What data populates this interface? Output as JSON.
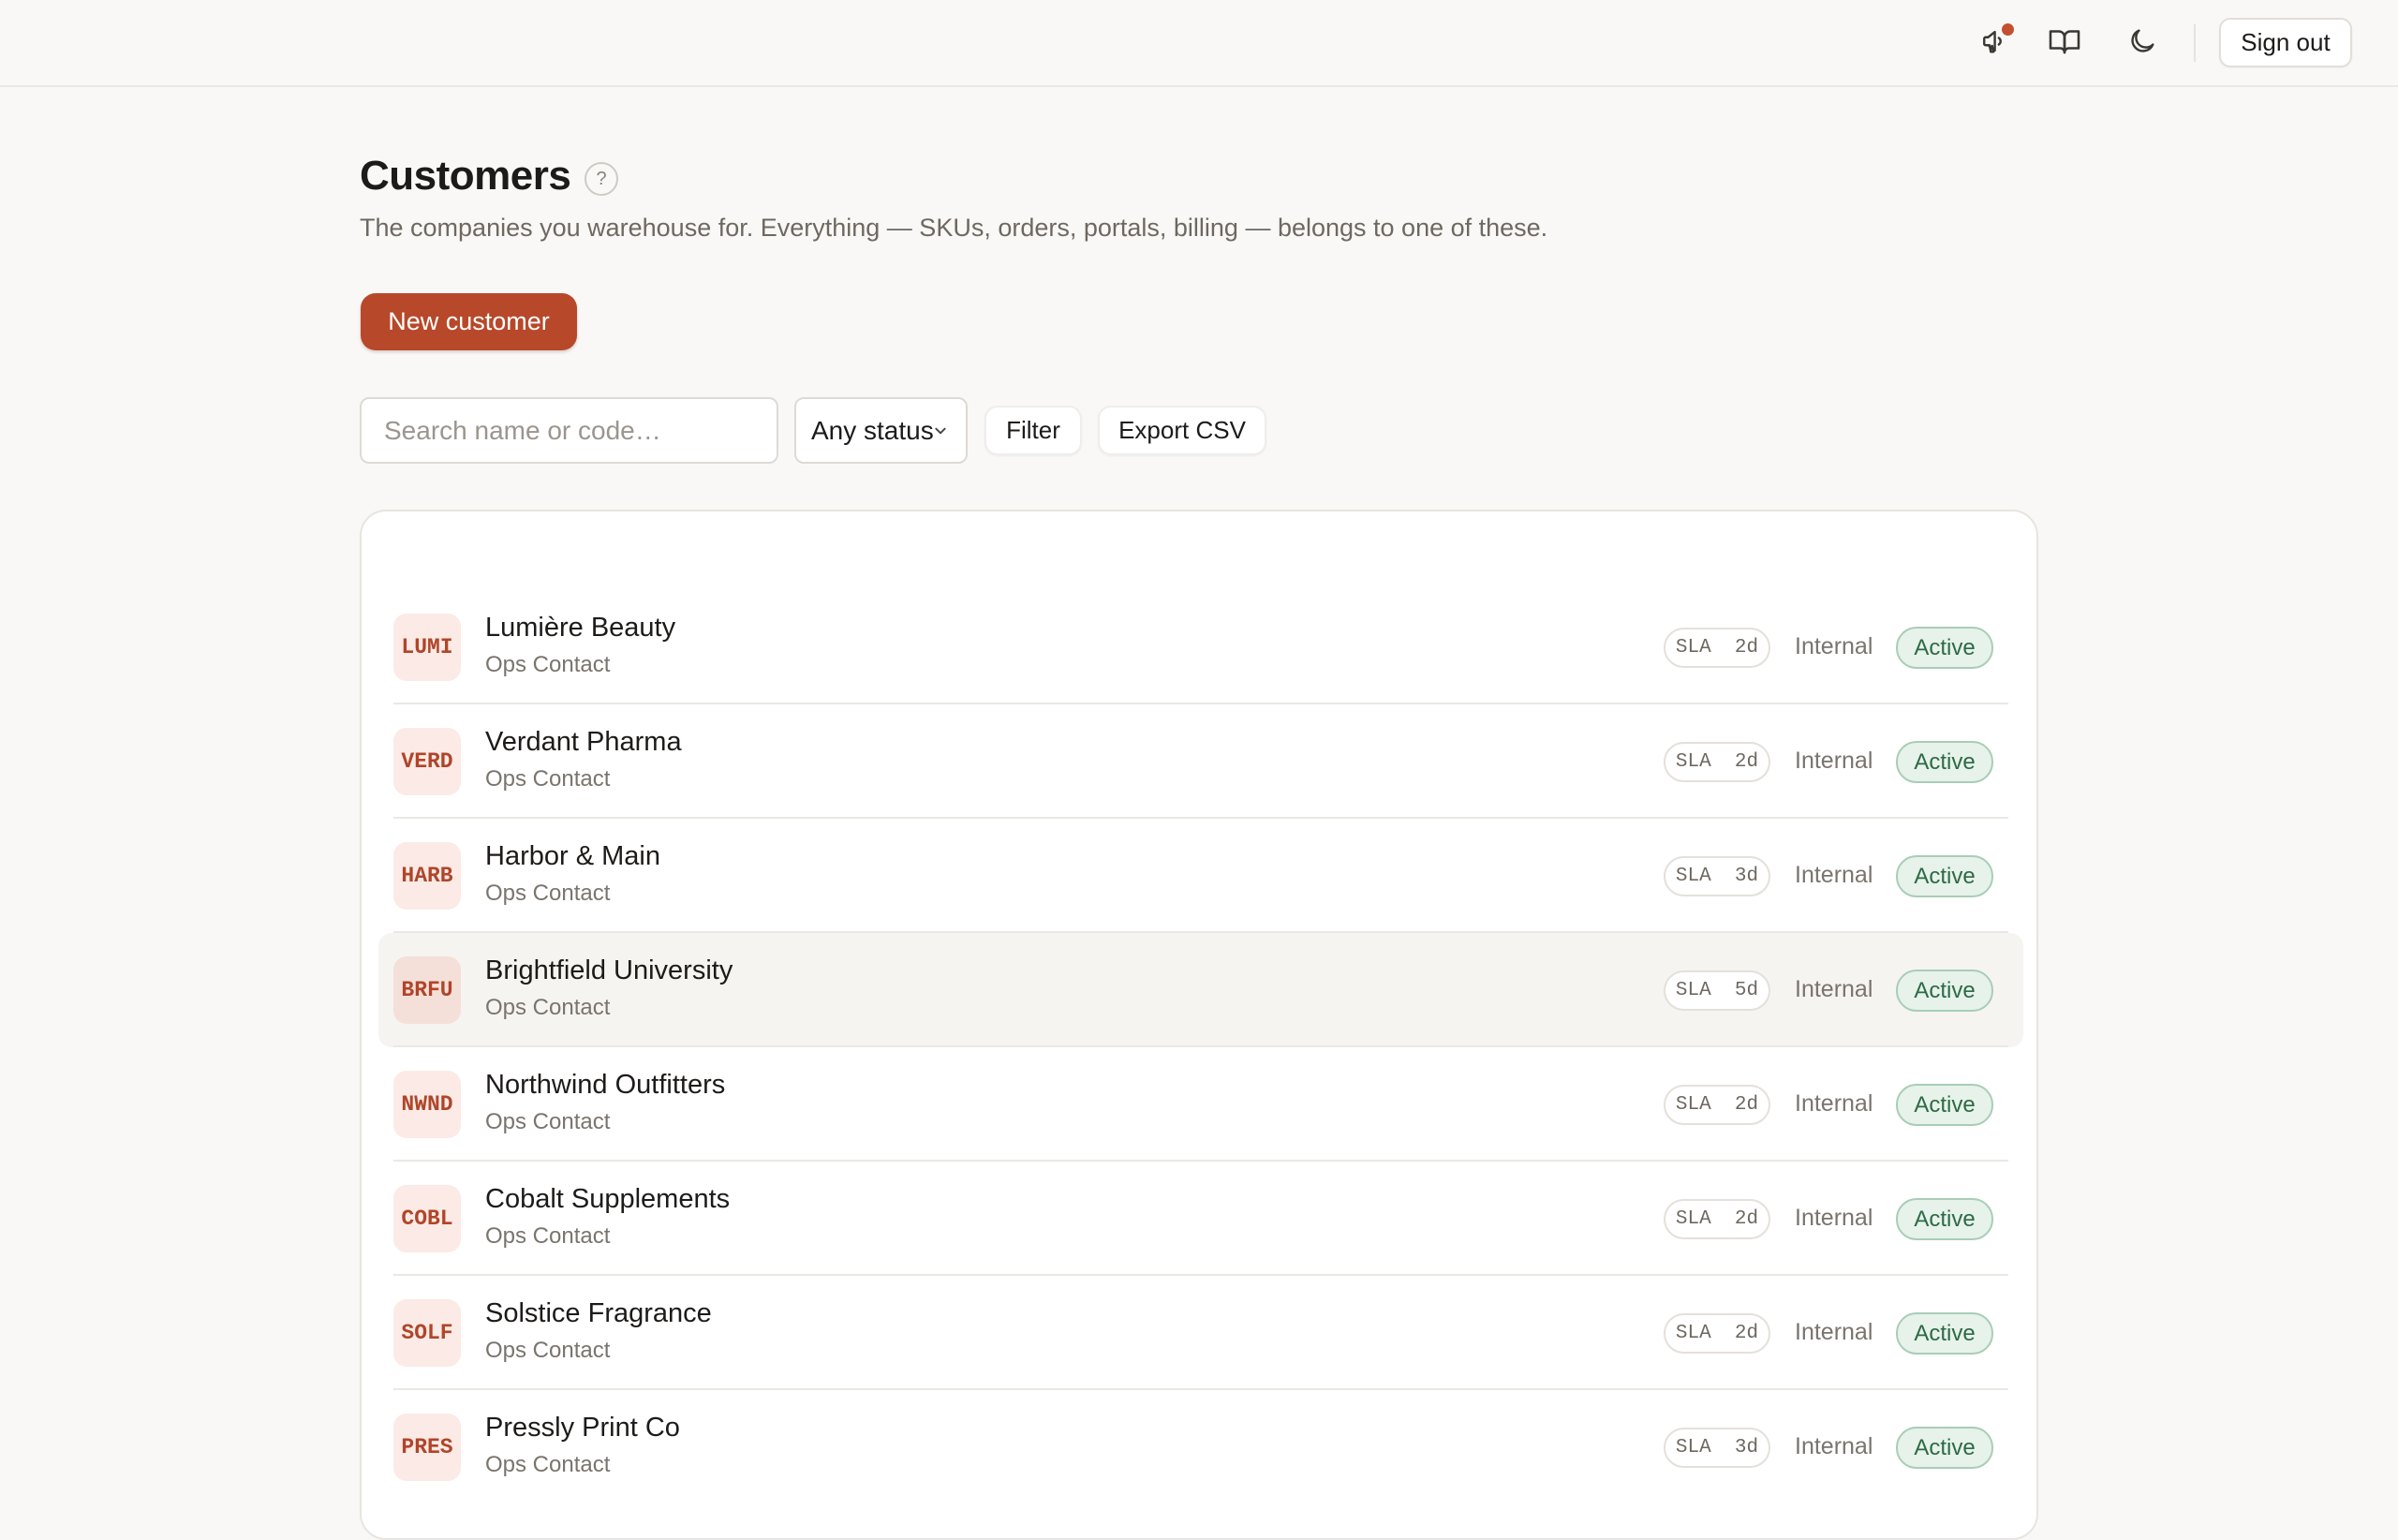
{
  "topbar": {
    "announcements_icon": "megaphone-icon",
    "docs_icon": "book-icon",
    "theme_icon": "moon-icon",
    "sign_out_label": "Sign out",
    "accent_color": "#c4502f"
  },
  "header": {
    "title": "Customers",
    "help_label": "?",
    "subtitle": "The companies you warehouse for. Everything — SKUs, orders, portals, billing — belongs to one of these."
  },
  "actions": {
    "new_customer_label": "New customer"
  },
  "filters": {
    "search_placeholder": "Search name or code…",
    "search_value": "",
    "status_selected": "Any status",
    "filter_label": "Filter",
    "export_label": "Export CSV"
  },
  "customers": [
    {
      "code": "LUMI",
      "name": "Lumière Beauty",
      "contact": "Ops Contact",
      "sla": "SLA  2d",
      "type": "Internal",
      "status": "Active"
    },
    {
      "code": "VERD",
      "name": "Verdant Pharma",
      "contact": "Ops Contact",
      "sla": "SLA  2d",
      "type": "Internal",
      "status": "Active"
    },
    {
      "code": "HARB",
      "name": "Harbor & Main",
      "contact": "Ops Contact",
      "sla": "SLA  3d",
      "type": "Internal",
      "status": "Active"
    },
    {
      "code": "BRFU",
      "name": "Brightfield University",
      "contact": "Ops Contact",
      "sla": "SLA  5d",
      "type": "Internal",
      "status": "Active"
    },
    {
      "code": "NWND",
      "name": "Northwind Outfitters",
      "contact": "Ops Contact",
      "sla": "SLA  2d",
      "type": "Internal",
      "status": "Active"
    },
    {
      "code": "COBL",
      "name": "Cobalt Supplements",
      "contact": "Ops Contact",
      "sla": "SLA  2d",
      "type": "Internal",
      "status": "Active"
    },
    {
      "code": "SOLF",
      "name": "Solstice Fragrance",
      "contact": "Ops Contact",
      "sla": "SLA  2d",
      "type": "Internal",
      "status": "Active"
    },
    {
      "code": "PRES",
      "name": "Pressly Print Co",
      "contact": "Ops Contact",
      "sla": "SLA  3d",
      "type": "Internal",
      "status": "Active"
    }
  ]
}
